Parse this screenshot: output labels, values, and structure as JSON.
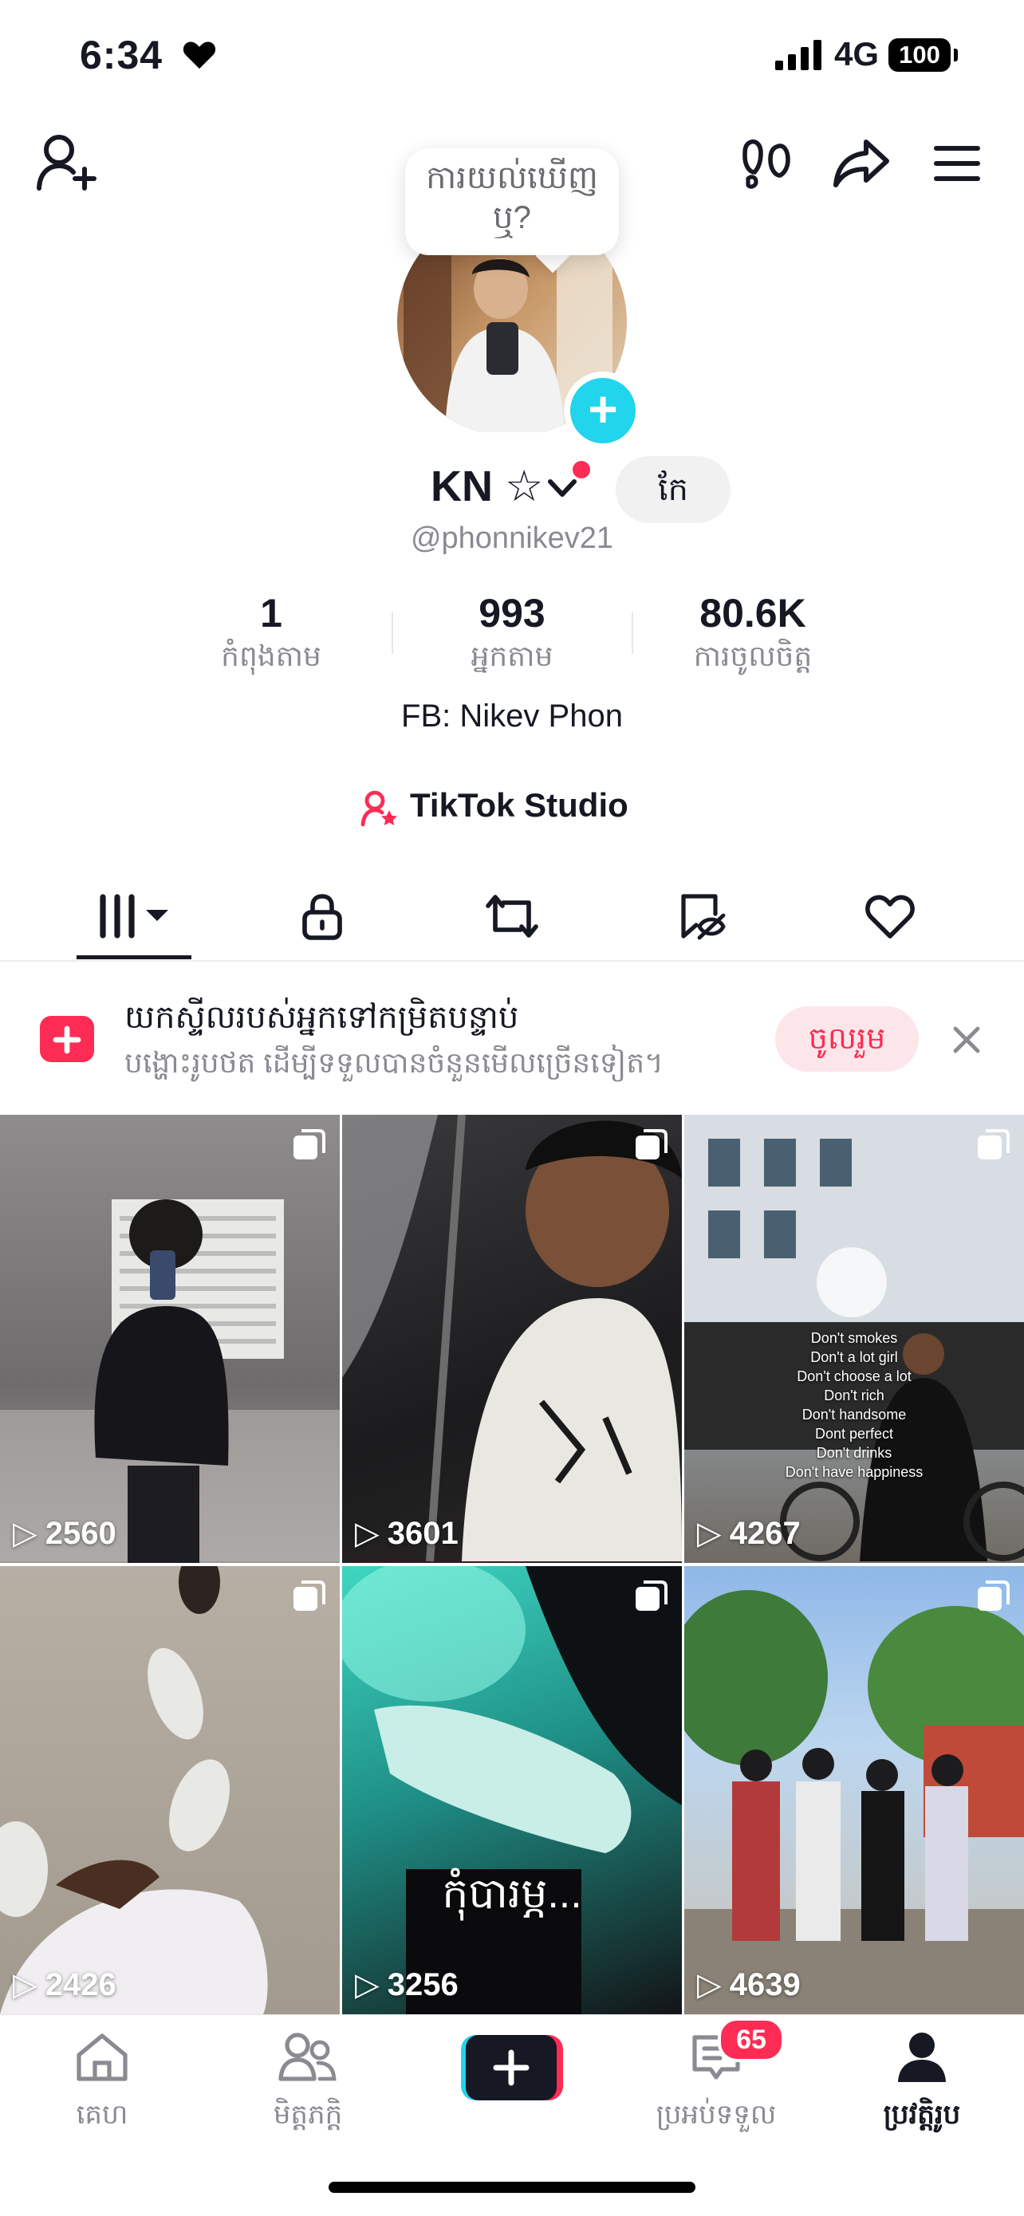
{
  "status_bar": {
    "time": "6:34",
    "network": "4G",
    "battery": "100"
  },
  "profile": {
    "tooltip": "ការយល់ឃើញ ឬ?",
    "display_name": "KN ☆",
    "edit_label": "កែ",
    "username": "@phonnikev21",
    "stats": [
      {
        "value": "1",
        "label": "កំពុងតាម"
      },
      {
        "value": "993",
        "label": "អ្នកតាម"
      },
      {
        "value": "80.6K",
        "label": "ការចូលចិត្ត"
      }
    ],
    "bio": "FB: Nikev Phon",
    "studio_label": "TikTok Studio"
  },
  "tabs": [
    {
      "icon": "grid-icon",
      "active": true
    },
    {
      "icon": "lock-icon",
      "active": false
    },
    {
      "icon": "repost-icon",
      "active": false
    },
    {
      "icon": "favorites-icon",
      "active": false
    },
    {
      "icon": "heart-icon",
      "active": false
    }
  ],
  "banner": {
    "title": "យកស្ទីលរបស់អ្នកទៅកម្រិតបន្ទាប់",
    "subtitle": "បង្ហោះរូបថត ដើម្បីទទួលបានចំនួនមើលច្រើនទៀត។",
    "join_label": "ចូលរួម"
  },
  "videos": [
    {
      "views": "2560"
    },
    {
      "views": "3601"
    },
    {
      "views": "4267",
      "overlay_lines": [
        "Don't smokes",
        "Don't a lot girl",
        "Don't choose a lot",
        "Don't rich",
        "Don't handsome",
        "Dont perfect",
        "Don't drinks",
        "Don't have happiness"
      ]
    },
    {
      "views": "2426"
    },
    {
      "views": "3256",
      "caption": "កុំបារម្ភ..."
    },
    {
      "views": "4639"
    }
  ],
  "bottom_nav": {
    "home": "គេហ",
    "friends": "មិត្តភក្តិ",
    "inbox": "ប្រអប់ទទួល",
    "inbox_badge": "65",
    "profile": "ប្រវត្តិរូប"
  },
  "colors": {
    "accent": "#fe2c55",
    "cyan": "#20d5ec",
    "text": "#161823",
    "muted": "#8a8b91"
  }
}
